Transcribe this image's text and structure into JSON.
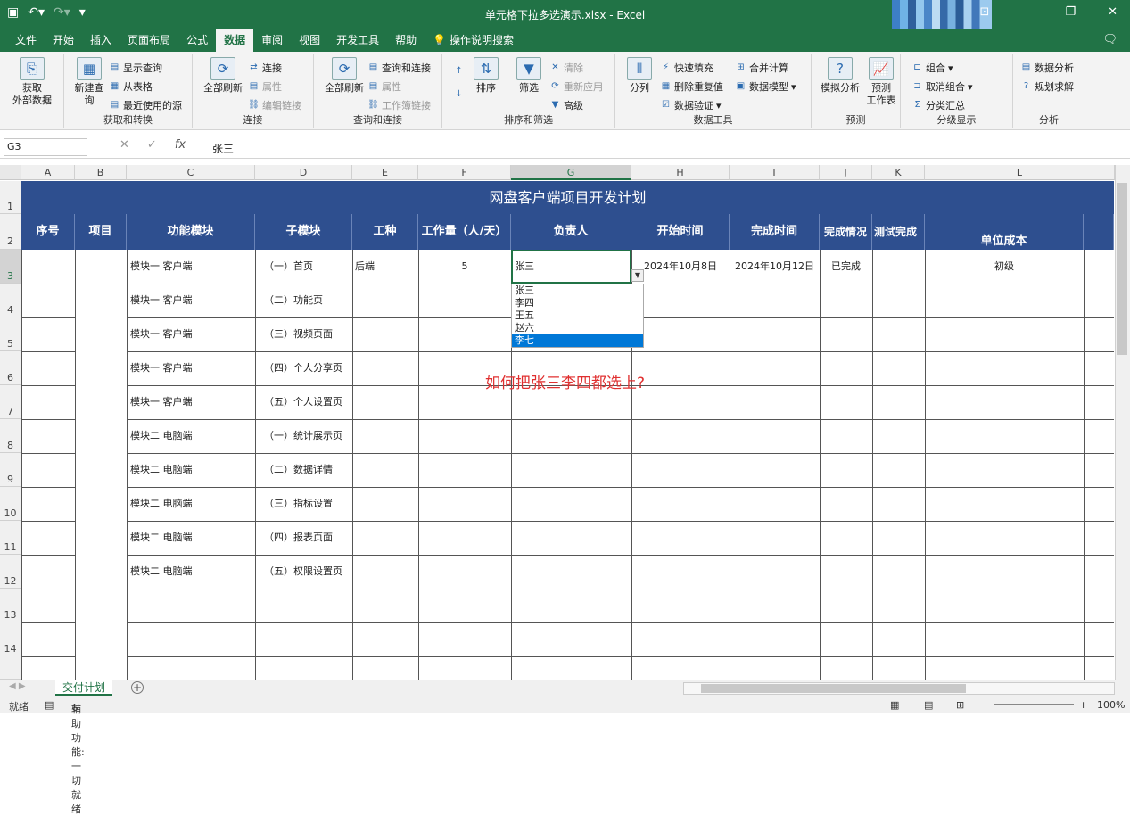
{
  "app": {
    "title": "单元格下拉多选演示.xlsx  -  Excel",
    "qat_icons": [
      "save-icon",
      "undo-icon",
      "redo-icon",
      "customize-icon"
    ],
    "accent": "#217346"
  },
  "tabs": [
    {
      "label": "文件"
    },
    {
      "label": "开始"
    },
    {
      "label": "插入"
    },
    {
      "label": "页面布局"
    },
    {
      "label": "公式"
    },
    {
      "label": "数据",
      "active": true
    },
    {
      "label": "审阅"
    },
    {
      "label": "视图"
    },
    {
      "label": "开发工具"
    },
    {
      "label": "帮助"
    },
    {
      "label": "操作说明搜索"
    }
  ],
  "ribbon": {
    "get_external": "获取\n外部数据",
    "new_query": "新建查\n询",
    "show_query": "显示查询",
    "from_table": "从表格",
    "recent_sources": "最近使用的源",
    "group_get": "获取和转换",
    "refresh_all_1": "全部刷新",
    "connections": "连接",
    "properties_1": "属性",
    "edit_links": "编辑链接",
    "group_connect": "连接",
    "refresh_all_2": "全部刷新",
    "queries_connections": "查询和连接",
    "properties_2": "属性",
    "workbook_links": "工作簿链接",
    "group_queries": "查询和连接",
    "sort": "排序",
    "filter": "筛选",
    "clear": "清除",
    "reapply": "重新应用",
    "advanced": "高级",
    "group_sort": "排序和筛选",
    "text_to_columns": "分列",
    "flash_fill": "快速填充",
    "remove_duplicates": "删除重复值",
    "data_validation": "数据验证",
    "consolidate": "合并计算",
    "data_model": "数据模型",
    "group_tools": "数据工具",
    "what_if": "模拟分析",
    "forecast_sheet": "预测\n工作表",
    "group_forecast": "预测",
    "group": "组合",
    "ungroup": "取消组合",
    "subtotal": "分类汇总",
    "group_outline": "分级显示",
    "data_analysis": "数据分析",
    "solver": "规划求解",
    "group_analysis": "分析"
  },
  "formula_bar": {
    "cell_ref": "G3",
    "value": "张三"
  },
  "columns": [
    "A",
    "B",
    "C",
    "D",
    "E",
    "F",
    "G",
    "H",
    "I",
    "J",
    "K",
    "L"
  ],
  "rows": [
    "1",
    "2",
    "3",
    "4",
    "5",
    "6",
    "7",
    "8",
    "9",
    "10",
    "11",
    "12",
    "13",
    "14"
  ],
  "sheet": {
    "banner_title": "网盘客户端项目开发计划",
    "headers": [
      "序号",
      "项目",
      "功能模块",
      "子模块",
      "工种",
      "工作量（人/天）",
      "负责人",
      "开始时间",
      "完成时间",
      "完成情况",
      "测试完成",
      "单位成本"
    ],
    "rows": [
      {
        "module": "模块一   客户端",
        "sub": "（一）首页",
        "role": "后端",
        "effort": "5",
        "owner": "张三",
        "start": "2024年10月8日",
        "end": "2024年10月12日",
        "status": "已完成",
        "cost": "初级"
      },
      {
        "module": "模块一   客户端",
        "sub": "（二）功能页"
      },
      {
        "module": "模块一   客户端",
        "sub": "（三）视频页面"
      },
      {
        "module": "模块一   客户端",
        "sub": "（四）个人分享页"
      },
      {
        "module": "模块一   客户端",
        "sub": "（五）个人设置页"
      },
      {
        "module": "模块二   电脑端",
        "sub": "（一）统计展示页"
      },
      {
        "module": "模块二   电脑端",
        "sub": "（二）数据详情"
      },
      {
        "module": "模块二   电脑端",
        "sub": "（三）指标设置"
      },
      {
        "module": "模块二   电脑端",
        "sub": "（四）报表页面"
      },
      {
        "module": "模块二   电脑端",
        "sub": "（五）权限设置页"
      }
    ]
  },
  "dropdown": {
    "options": [
      "张三",
      "李四",
      "王五",
      "赵六",
      "李七"
    ],
    "highlighted": "李七"
  },
  "annotation": "如何把张三李四都选上?",
  "sheet_tab": "交付计划",
  "status": {
    "ready": "就绪",
    "accessibility": "辅助功能: 一切就绪",
    "zoom": "100%"
  }
}
